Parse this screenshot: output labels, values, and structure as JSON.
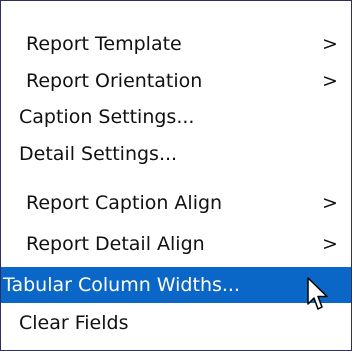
{
  "menu": {
    "items": [
      {
        "label": "Report Template",
        "arrow": ">"
      },
      {
        "label": "Report Orientation",
        "arrow": ">"
      },
      {
        "label": "Caption Settings..."
      },
      {
        "label": "Detail Settings..."
      },
      {
        "label": "Report Caption Align",
        "arrow": ">"
      },
      {
        "label": "Report Detail Align",
        "arrow": ">"
      },
      {
        "label": "Tabular Column Widths...",
        "highlighted": true
      },
      {
        "label": "Clear Fields"
      }
    ]
  },
  "colors": {
    "highlight": "#0a67c8",
    "highlight_text": "#ffffff",
    "text": "#111111",
    "border": "#2f2f5f"
  },
  "icons": {
    "cursor": "arrow-cursor-icon"
  }
}
